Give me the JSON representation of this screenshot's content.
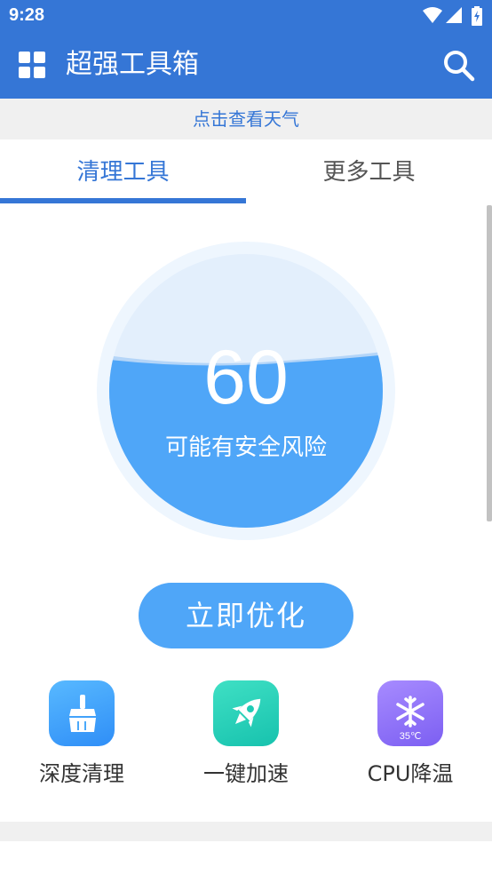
{
  "status_bar": {
    "time": "9:28"
  },
  "app_bar": {
    "title": "超强工具箱",
    "menu_icon": "grid-icon",
    "search_icon": "search-icon"
  },
  "weather_banner": {
    "text": "点击查看天气"
  },
  "tabs": [
    {
      "label": "清理工具",
      "selected": true
    },
    {
      "label": "更多工具",
      "selected": false
    }
  ],
  "gauge": {
    "value": "60",
    "status": "可能有安全风险",
    "fill_level": 0.6
  },
  "optimize_button": {
    "label": "立即优化"
  },
  "tools": [
    {
      "label": "深度清理",
      "icon": "broom-icon"
    },
    {
      "label": "一键加速",
      "icon": "rocket-icon"
    },
    {
      "label": "CPU降温",
      "icon": "snowflake-icon",
      "badge": "35℃"
    }
  ],
  "colors": {
    "primary": "#3576d6",
    "gauge_fill": "#4fa6f8",
    "background_band": "#f0f0f0"
  }
}
